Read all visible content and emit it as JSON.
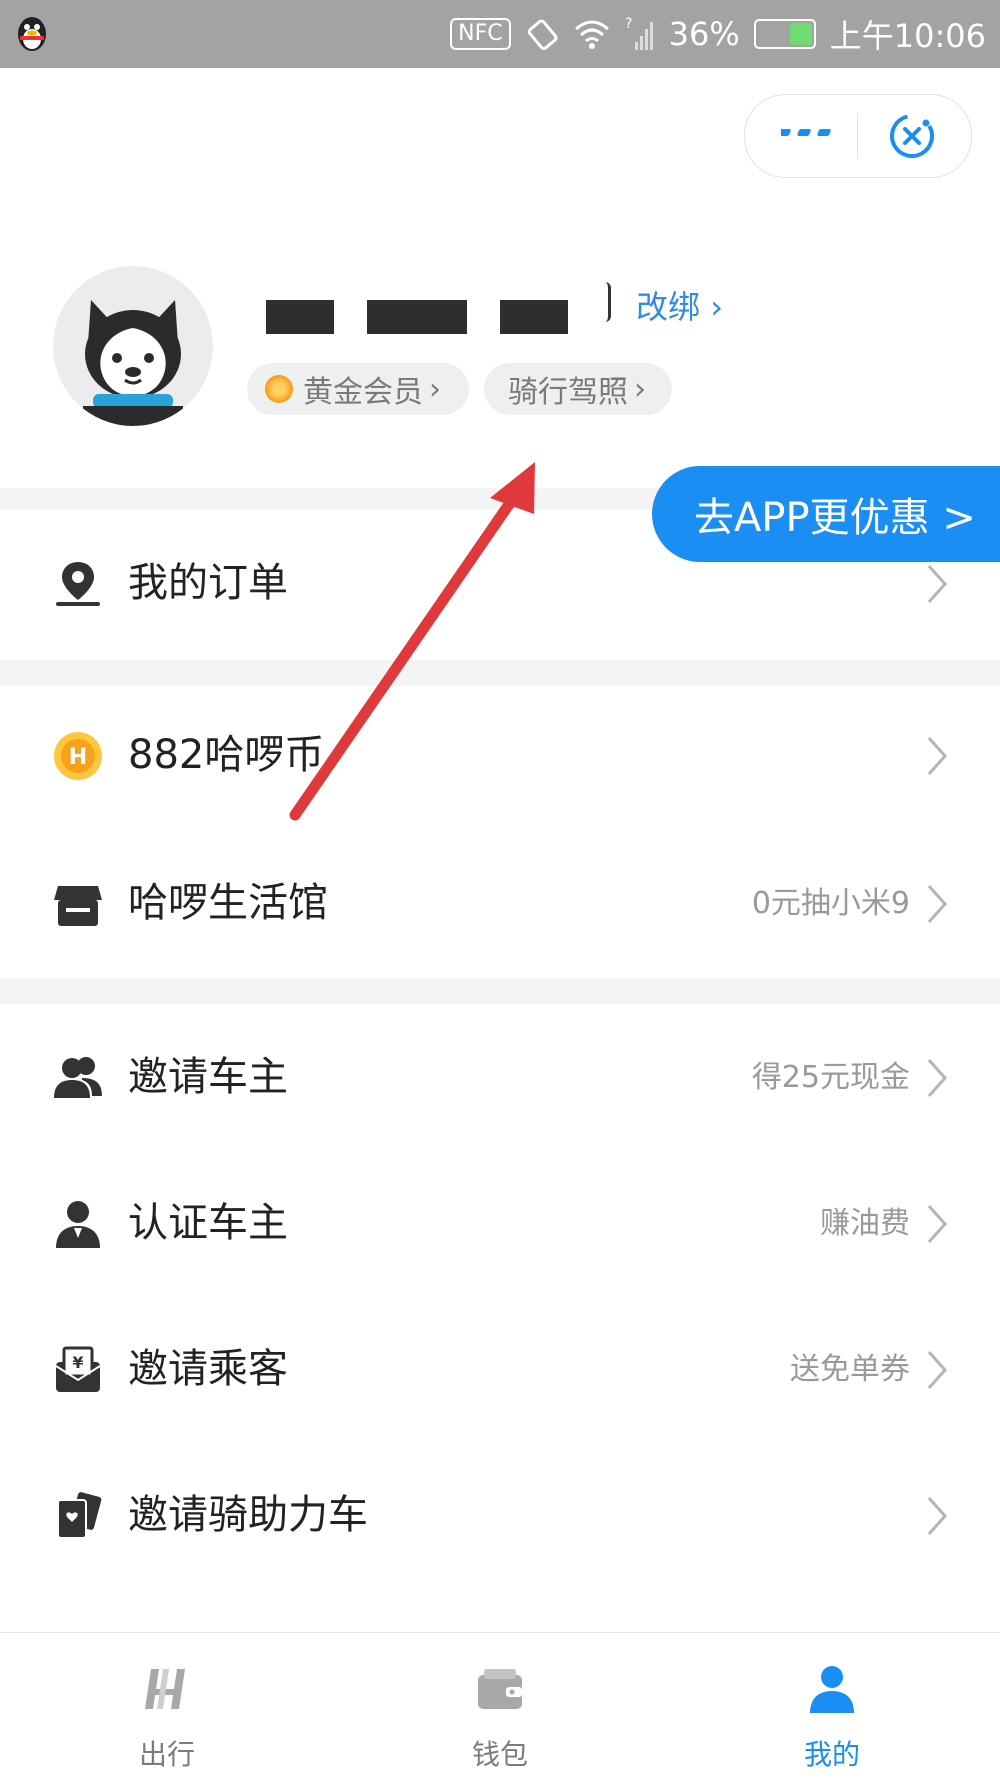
{
  "status_bar": {
    "nfc": "NFC",
    "battery": "36%",
    "time": "上午10:06"
  },
  "profile": {
    "rebind_label": "改绑",
    "member_badge": "黄金会员",
    "license_badge": "骑行驾照"
  },
  "app_banner": "去APP更优惠 >",
  "menu": {
    "orders": {
      "label": "我的订单",
      "sub": ""
    },
    "coins": {
      "label": "882哈啰币",
      "sub": ""
    },
    "store": {
      "label": "哈啰生活馆",
      "sub": "0元抽小米9"
    },
    "invite_owner": {
      "label": "邀请车主",
      "sub": "得25元现金"
    },
    "verify_owner": {
      "label": "认证车主",
      "sub": "赚油费"
    },
    "invite_passenger": {
      "label": "邀请乘客",
      "sub": "送免单券"
    },
    "invite_ebike": {
      "label": "邀请骑助力车",
      "sub": ""
    }
  },
  "tabbar": {
    "tab1": "出行",
    "tab2": "钱包",
    "tab3": "我的"
  },
  "colors": {
    "accent": "#1a8ef2",
    "annotation_arrow": "#e0393b"
  }
}
